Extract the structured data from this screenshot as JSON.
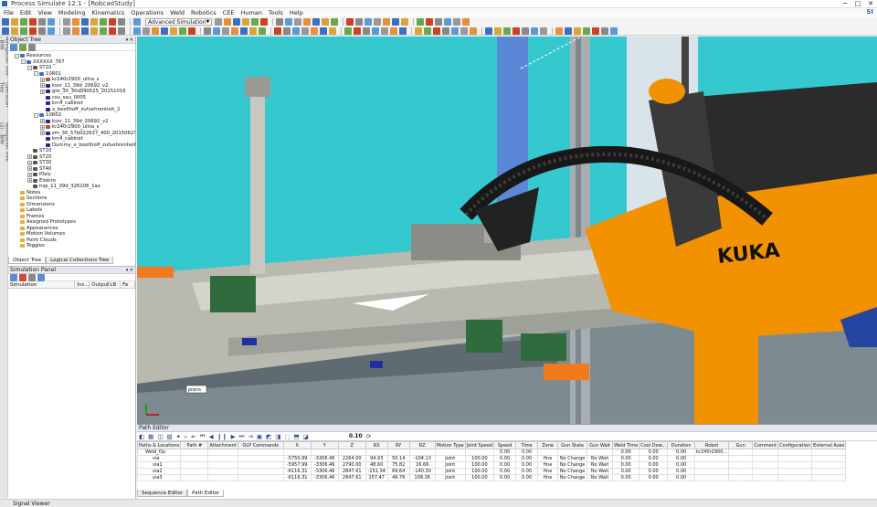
{
  "window": {
    "title": "Process Simulate 12.1 - [RobcadStudy]",
    "brand": "SI"
  },
  "menu": [
    "File",
    "Edit",
    "View",
    "Modeling",
    "Kinematics",
    "Operations",
    "Weld",
    "Robotics",
    "CEE",
    "Human",
    "Tools",
    "Help"
  ],
  "toolbar": {
    "mode_dropdown": "Advanced Simulation"
  },
  "side_tabs": [
    "Navigation Tree - BIW",
    "Operation Tree",
    "Navigation Tree (2) - BIW"
  ],
  "object_tree": {
    "title": "Object Tree",
    "rows": [
      {
        "label": "Resources",
        "indent": 1,
        "exp": "-",
        "color": "#3a6fc4"
      },
      {
        "label": "XXXXXX_767",
        "indent": 2,
        "exp": "-",
        "color": "#3a6fc4"
      },
      {
        "label": "ST10",
        "indent": 3,
        "exp": "-",
        "color": "#555"
      },
      {
        "label": "10R01",
        "indent": 4,
        "exp": "-",
        "color": "#3a6fc4"
      },
      {
        "label": "kr240r2900_ultra_s",
        "indent": 5,
        "exp": "+",
        "color": "#c05020"
      },
      {
        "label": "kssr_11_39d_20692_v2",
        "indent": 5,
        "exp": "+",
        "color": "#2a2a80"
      },
      {
        "label": "gre_30_30d040525_20151016",
        "indent": 5,
        "exp": "+",
        "color": "#2a2a80"
      },
      {
        "label": "csu_sau_0005",
        "indent": 5,
        "exp": "",
        "color": "#2a2a80"
      },
      {
        "label": "krc4_cabinet",
        "indent": 5,
        "exp": "",
        "color": "#2a2a80"
      },
      {
        "label": "x_boellhoff_zufuehrenheit_2",
        "indent": 5,
        "exp": "",
        "color": "#2a2a80"
      },
      {
        "label": "10R02",
        "indent": 4,
        "exp": "-",
        "color": "#3a6fc4"
      },
      {
        "label": "kssr_11_39d_20692_v2",
        "indent": 5,
        "exp": "+",
        "color": "#2a2a80"
      },
      {
        "label": "kr240r2900_ultra_s",
        "indent": 5,
        "exp": "+",
        "color": "#c05020"
      },
      {
        "label": "zm_30_57b022637_400_2015062!",
        "indent": 5,
        "exp": "+",
        "color": "#2a2a80"
      },
      {
        "label": "krc4_cabinet",
        "indent": 5,
        "exp": "",
        "color": "#2a2a80"
      },
      {
        "label": "Dummy_x_boellhoff_zufuehrenheit",
        "indent": 5,
        "exp": "",
        "color": "#2a2a80"
      },
      {
        "label": "ST10",
        "indent": 3,
        "exp": "",
        "color": "#555"
      },
      {
        "label": "ST20",
        "indent": 3,
        "exp": "+",
        "color": "#555"
      },
      {
        "label": "ST30",
        "indent": 3,
        "exp": "+",
        "color": "#555"
      },
      {
        "label": "ST40",
        "indent": 3,
        "exp": "+",
        "color": "#555"
      },
      {
        "label": "Pfaly",
        "indent": 3,
        "exp": "+",
        "color": "#555"
      },
      {
        "label": "Elekiro",
        "indent": 3,
        "exp": "+",
        "color": "#555"
      },
      {
        "label": "hsp_11_39d_326106_1ax",
        "indent": 3,
        "exp": "",
        "color": "#555"
      },
      {
        "label": "Notes",
        "indent": 1,
        "exp": "",
        "color": "#e0b040"
      },
      {
        "label": "Sections",
        "indent": 1,
        "exp": "",
        "color": "#e0b040"
      },
      {
        "label": "Dimensions",
        "indent": 1,
        "exp": "",
        "color": "#e0b040"
      },
      {
        "label": "Labels",
        "indent": 1,
        "exp": "",
        "color": "#e0b040"
      },
      {
        "label": "Frames",
        "indent": 1,
        "exp": "",
        "color": "#e0b040"
      },
      {
        "label": "Assigned Prototypes",
        "indent": 1,
        "exp": "",
        "color": "#e0b040"
      },
      {
        "label": "Appearances",
        "indent": 1,
        "exp": "",
        "color": "#e0b040"
      },
      {
        "label": "Motion Volumes",
        "indent": 1,
        "exp": "",
        "color": "#e0b040"
      },
      {
        "label": "Point Clouds",
        "indent": 1,
        "exp": "",
        "color": "#e0b040"
      },
      {
        "label": "Toggles",
        "indent": 1,
        "exp": "",
        "color": "#e0b040"
      }
    ],
    "tabs": [
      "Object Tree",
      "Logical Collections Tree"
    ]
  },
  "simulation_panel": {
    "title": "Simulation Panel",
    "columns": [
      "Simulation",
      "Ins...",
      "Output",
      "LB",
      "Fe"
    ]
  },
  "path_editor": {
    "title": "Path Editor",
    "speed_value": "0.10",
    "columns": [
      "Paths & Locations",
      "Path #",
      "Attachment",
      "OLP Commands",
      "X",
      "Y",
      "Z",
      "RX",
      "RY",
      "RZ",
      "Motion Type",
      "Joint Speed",
      "Speed",
      "Time",
      "Zone",
      "Gun State",
      "Gun Wait",
      "Weld Time",
      "Cool Dow...",
      "Duration",
      "Robot",
      "Gun",
      "Comment",
      "Configuration",
      "External Axes"
    ],
    "parent_row": {
      "name": "Weld_Op",
      "joint_speed": "",
      "speed": "0.00",
      "time": "0.00",
      "weld_time": "0.00",
      "cool": "0.00",
      "duration": "0.00",
      "robot": "kr240r2900..."
    },
    "rows": [
      {
        "name": "via",
        "x": "-5750.99",
        "y": "-3306.46",
        "z": "2264.00",
        "rx": "94.93",
        "ry": "50.14",
        "rz": "-104.13",
        "motion": "Joint",
        "jspeed": "100.00",
        "speed": "0.00",
        "time": "0.00",
        "zone": "fine",
        "gstate": "No Change",
        "gwait": "No Wait",
        "weld": "0.00",
        "cool": "0.00",
        "dur": "0.00"
      },
      {
        "name": "via1",
        "x": "-5957.99",
        "y": "-3306.46",
        "z": "2790.00",
        "rx": "48.60",
        "ry": "75.82",
        "rz": "16.66",
        "motion": "Joint",
        "jspeed": "100.00",
        "speed": "0.00",
        "time": "0.00",
        "zone": "fine",
        "gstate": "No Change",
        "gwait": "No Wait",
        "weld": "0.00",
        "cool": "0.00",
        "dur": "0.00"
      },
      {
        "name": "via2",
        "x": "-6116.31",
        "y": "-3306.46",
        "z": "2847.61",
        "rx": "-151.34",
        "ry": "69.64",
        "rz": "-140.30",
        "motion": "Joint",
        "jspeed": "100.00",
        "speed": "0.00",
        "time": "0.00",
        "zone": "fine",
        "gstate": "No Change",
        "gwait": "No Wait",
        "weld": "0.00",
        "cool": "0.00",
        "dur": "0.00"
      },
      {
        "name": "via3",
        "x": "-6116.31",
        "y": "-3306.46",
        "z": "2847.61",
        "rx": "157.47",
        "ry": "49.76",
        "rz": "108.26",
        "motion": "Joint",
        "jspeed": "100.00",
        "speed": "0.00",
        "time": "0.00",
        "zone": "fine",
        "gstate": "No Change",
        "gwait": "No Wait",
        "weld": "0.00",
        "cool": "0.00",
        "dur": "0.00"
      }
    ],
    "tabs": [
      "Sequence Editor",
      "Path Editor"
    ]
  },
  "viewport": {
    "robot_brand": "KUKA",
    "tag": "prens"
  },
  "status": {
    "text": "Signal Viewer"
  }
}
